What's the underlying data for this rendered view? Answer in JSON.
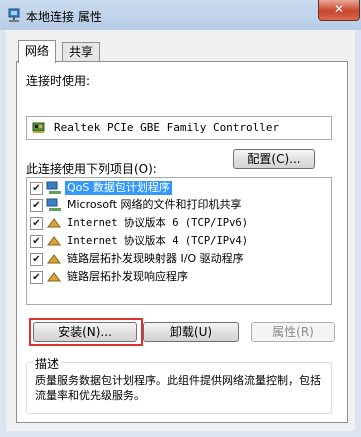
{
  "window": {
    "title": "本地连接 属性",
    "close_glyph": "✕"
  },
  "tabs": [
    {
      "label": "网络"
    },
    {
      "label": "共享"
    }
  ],
  "connect_using": {
    "label": "连接时使用:",
    "adapter_name": "Realtek PCIe GBE Family Controller",
    "configure_button": "配置(C)..."
  },
  "items_section": {
    "label": "此连接使用下列项目(O):",
    "items": [
      {
        "label": "QoS 数据包计划程序",
        "checked": true,
        "selected": true,
        "icon": "network-client-icon"
      },
      {
        "label": "Microsoft 网络的文件和打印机共享",
        "checked": true,
        "selected": false,
        "icon": "network-client-icon"
      },
      {
        "label": "Internet 协议版本 6 (TCP/IPv6)",
        "checked": true,
        "selected": false,
        "icon": "protocol-icon"
      },
      {
        "label": "Internet 协议版本 4 (TCP/IPv4)",
        "checked": true,
        "selected": false,
        "icon": "protocol-icon"
      },
      {
        "label": "链路层拓扑发现映射器 I/O 驱动程序",
        "checked": true,
        "selected": false,
        "icon": "protocol-icon"
      },
      {
        "label": "链路层拓扑发现响应程序",
        "checked": true,
        "selected": false,
        "icon": "protocol-icon"
      }
    ]
  },
  "buttons": {
    "install": "安装(N)...",
    "uninstall": "卸载(U)",
    "properties": "属性(R)"
  },
  "description": {
    "title": "描述",
    "text": "质量服务数据包计划程序。此组件提供网络流量控制，包括流量率和优先级服务。"
  },
  "colors": {
    "highlight_border": "#e0322b",
    "selection": "#3399ff"
  }
}
